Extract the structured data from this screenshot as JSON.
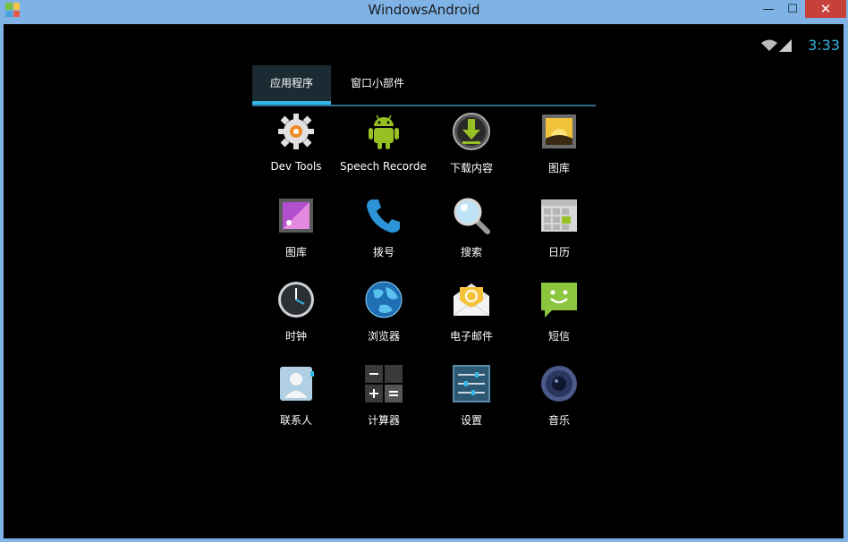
{
  "window": {
    "title": "WindowsAndroid",
    "minimize_glyph": "—",
    "maximize_glyph": "☐",
    "close_glyph": "✕"
  },
  "status_bar": {
    "time": "3:33",
    "icons": [
      "wifi-icon",
      "signal-icon"
    ],
    "accent_color": "#33b5e5"
  },
  "tabs": [
    {
      "label": "应用程序",
      "selected": true
    },
    {
      "label": "窗口小部件",
      "selected": false
    }
  ],
  "apps": [
    {
      "label": "Dev Tools",
      "icon": "dev-tools-icon"
    },
    {
      "label": "Speech Recorder",
      "icon": "android-robot-icon"
    },
    {
      "label": "下载内容",
      "icon": "download-icon"
    },
    {
      "label": "图库",
      "icon": "gallery-icon"
    },
    {
      "label": "图库",
      "icon": "gallery-purple-icon"
    },
    {
      "label": "拨号",
      "icon": "phone-icon"
    },
    {
      "label": "搜索",
      "icon": "search-icon"
    },
    {
      "label": "日历",
      "icon": "calendar-icon"
    },
    {
      "label": "时钟",
      "icon": "clock-icon"
    },
    {
      "label": "浏览器",
      "icon": "globe-icon"
    },
    {
      "label": "电子邮件",
      "icon": "email-icon"
    },
    {
      "label": "短信",
      "icon": "message-icon"
    },
    {
      "label": "联系人",
      "icon": "contacts-icon"
    },
    {
      "label": "计算器",
      "icon": "calculator-icon"
    },
    {
      "label": "设置",
      "icon": "settings-icon"
    },
    {
      "label": "音乐",
      "icon": "music-icon"
    }
  ]
}
